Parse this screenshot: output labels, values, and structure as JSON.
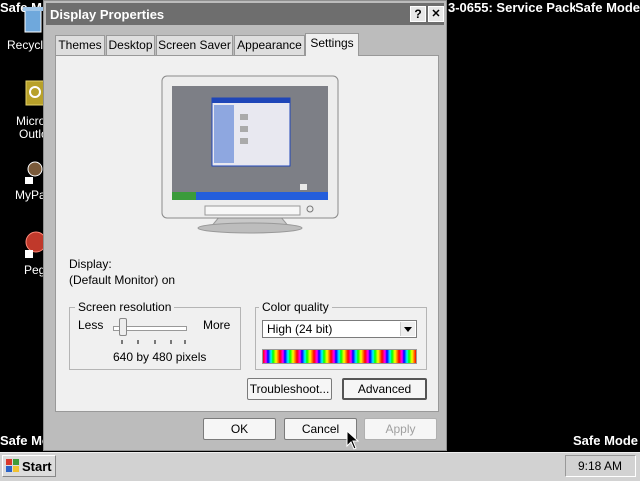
{
  "desktop": {
    "safe_mode_labels": [
      "Safe Mode",
      "Safe Mode",
      "Safe Mode",
      "Safe Mode"
    ],
    "build_text": "3-0655: Service Pack 3",
    "icons": [
      {
        "label": "Recycl",
        "icon": "recycle-bin-icon"
      },
      {
        "label": "Micro",
        "label2": "Outlo",
        "icon": "outlook-icon"
      },
      {
        "label": "MyPa",
        "icon": "mypal-icon"
      },
      {
        "label": "Peg",
        "icon": "pegasus-icon"
      }
    ]
  },
  "window": {
    "title": "Display Properties",
    "help_label": "?",
    "close_label": "✕",
    "tabs": [
      {
        "label": "Themes"
      },
      {
        "label": "Desktop"
      },
      {
        "label": "Screen Saver"
      },
      {
        "label": "Appearance"
      },
      {
        "label": "Settings",
        "active": true
      }
    ],
    "display_label": "Display:",
    "display_value": "(Default Monitor) on",
    "screen_resolution": {
      "title": "Screen resolution",
      "less": "Less",
      "more": "More",
      "value": "640 by 480 pixels",
      "slider_level": 0
    },
    "color_quality": {
      "title": "Color quality",
      "selected": "High (24 bit)"
    },
    "buttons": {
      "troubleshoot": "Troubleshoot...",
      "advanced": "Advanced",
      "ok": "OK",
      "cancel": "Cancel",
      "apply": "Apply"
    }
  },
  "taskbar": {
    "start": "Start",
    "clock": "9:18 AM"
  },
  "colors": {
    "window_bg": "#bcbcbc",
    "panel_bg": "#f0f0f0",
    "titlebar": "#6e6e6e",
    "desktop": "#000000"
  }
}
